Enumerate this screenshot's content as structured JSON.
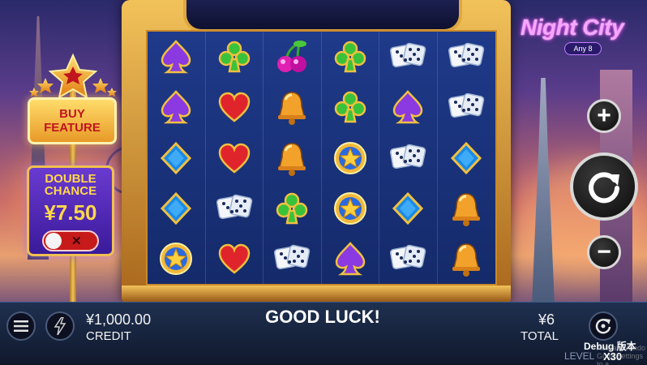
{
  "game": {
    "logo_title": "Night City",
    "logo_subtitle": "Any 8"
  },
  "left_panel": {
    "buy_feature_line1": "BUY",
    "buy_feature_line2": "FEATURE",
    "double_chance_line1": "DOUBLE",
    "double_chance_line2": "CHANCE",
    "double_chance_amount": "¥7.50",
    "toggle_state_symbol": "✕"
  },
  "reels": [
    [
      "spade-icon",
      "spade-icon",
      "diamond-icon",
      "diamond-icon",
      "star-coin-icon"
    ],
    [
      "club-icon",
      "heart-icon",
      "heart-icon",
      "dice-icon",
      "heart-icon"
    ],
    [
      "cherry-icon",
      "bell-icon",
      "bell-icon",
      "club-icon",
      "dice-icon"
    ],
    [
      "club-icon",
      "club-icon",
      "star-coin-icon",
      "star-coin-icon",
      "spade-icon"
    ],
    [
      "dice-icon",
      "spade-icon",
      "dice-icon",
      "diamond-icon",
      "dice-icon"
    ],
    [
      "dice-icon",
      "dice-icon",
      "diamond-icon",
      "bell-icon",
      "bell-icon"
    ]
  ],
  "controls": {
    "increase_bet": "+",
    "decrease_bet": "−",
    "spin_icon": "refresh-icon",
    "menu_icon": "hamburger-icon",
    "turbo_icon": "lightning-icon",
    "autoplay_icon": "autoplay-icon"
  },
  "bottom_bar": {
    "credit_value": "¥1,000.00",
    "credit_label": "CREDIT",
    "message": "GOOD LUCK!",
    "total_value": "¥6",
    "total_label": "TOTAL",
    "debug_label": "Debug 版本",
    "multiplier": "X30",
    "level_label": "LEVEL",
    "os_watermark_line1": "Activate Windo",
    "os_watermark_line2": "Go to Settings to a"
  },
  "colors": {
    "reel_bg": "#1f3a8a",
    "frame_gold": "#f2c25a",
    "buy_text": "#c2141e",
    "double_chance_bg": "#6a3ad0",
    "logo_pink": "#f4a8ff"
  }
}
